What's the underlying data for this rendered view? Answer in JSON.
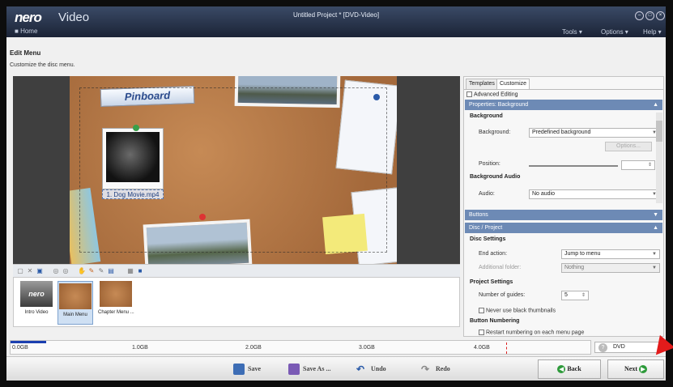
{
  "app": {
    "logo": "nero",
    "logo_product": "Video",
    "home": "Home",
    "window_title": "Untitled Project * [DVD-Video]"
  },
  "menu": {
    "tools": "Tools ▾",
    "options": "Options ▾",
    "help": "Help ▾"
  },
  "page": {
    "heading": "Edit Menu",
    "subheading": "Customize the disc menu."
  },
  "preview": {
    "pinboard_title": "Pinboard",
    "video_label": "1. Dog Movie.mp4"
  },
  "thumbnails": [
    {
      "label": "Intro Video"
    },
    {
      "label": "Main Menu"
    },
    {
      "label": "Chapter Menu ..."
    }
  ],
  "panel": {
    "tabs": [
      "Templates",
      "Customize"
    ],
    "advanced_editing": "Advanced Editing",
    "properties_header": "Properties: Background",
    "background_group": "Background",
    "background_label": "Background:",
    "background_value": "Predefined background",
    "options_button": "Options...",
    "position_label": "Position:",
    "bg_audio_group": "Background Audio",
    "audio_label": "Audio:",
    "audio_value": "No audio",
    "buttons_header": "Buttons",
    "disc_header": "Disc / Project",
    "disc_settings_group": "Disc Settings",
    "end_action_label": "End action:",
    "end_action_value": "Jump to menu",
    "additional_folder_label": "Additional folder:",
    "additional_folder_value": "Nothing",
    "project_settings_group": "Project Settings",
    "guides_label": "Number of guides:",
    "guides_value": "5",
    "never_black": "Never use black thumbnails",
    "button_numbering_group": "Button Numbering",
    "restart_numbering": "Restart numbering on each menu page"
  },
  "ruler": {
    "ticks": [
      "0.0GB",
      "1.0GB",
      "2.0GB",
      "3.0GB",
      "4.0GB"
    ],
    "disc_type": "DVD"
  },
  "actions": {
    "save": "Save",
    "save_as": "Save As ...",
    "undo": "Undo",
    "redo": "Redo",
    "back": "Back",
    "next": "Next"
  },
  "colors": {
    "accent": "#6d8ab5",
    "title_bar": "#1b2336",
    "ruler_used": "#1b3fb0",
    "next_arrow": "#e21b1b"
  }
}
